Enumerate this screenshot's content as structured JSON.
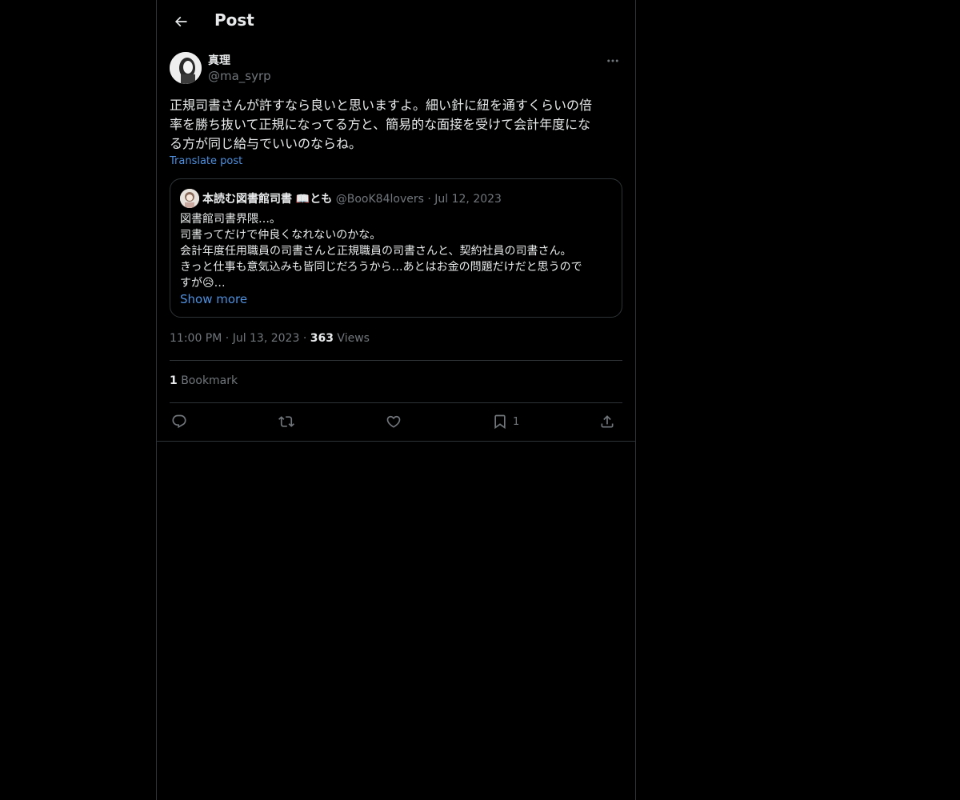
{
  "header": {
    "title": "Post"
  },
  "author": {
    "name": "真理",
    "handle": "@ma_syrp"
  },
  "post": {
    "text": "正規司書さんが許すなら良いと思いますよ。細い針に紐を通すくらいの倍\n率を勝ち抜いて正規になってる方と、簡易的な面接を受けて会計年度にな\nる方が同じ給与でいいのならね。",
    "translate_label": "Translate post"
  },
  "quote": {
    "name": "本読む図書館司書 📖とも",
    "handle": "@BooK84lovers",
    "dot": "·",
    "date": "Jul 12, 2023",
    "text": "図書館司書界隈…。\n司書ってだけで仲良くなれないのかな。\n会計年度任用職員の司書さんと正規職員の司書さんと、契約社員の司書さん。\nきっと仕事も意気込みも皆同じだろうから…あとはお金の問題だけだと思うので\nすが😥…",
    "show_more": "Show more"
  },
  "meta": {
    "time": "11:00 PM",
    "dot1": "·",
    "date": "Jul 13, 2023",
    "dot2": "·",
    "views_count": "363",
    "views_label": "Views"
  },
  "bookmarks": {
    "count": "1",
    "label": "Bookmark"
  },
  "actions": {
    "reply": {
      "icon": "reply-icon"
    },
    "repost": {
      "icon": "repost-icon"
    },
    "like": {
      "icon": "heart-icon"
    },
    "bookmark": {
      "icon": "bookmark-icon",
      "count": "1"
    },
    "share": {
      "icon": "share-icon"
    }
  },
  "colors": {
    "background": "#000000",
    "text": "#e7e9ea",
    "muted": "#71767b",
    "link": "#4f8fde",
    "border": "#2f3336"
  }
}
